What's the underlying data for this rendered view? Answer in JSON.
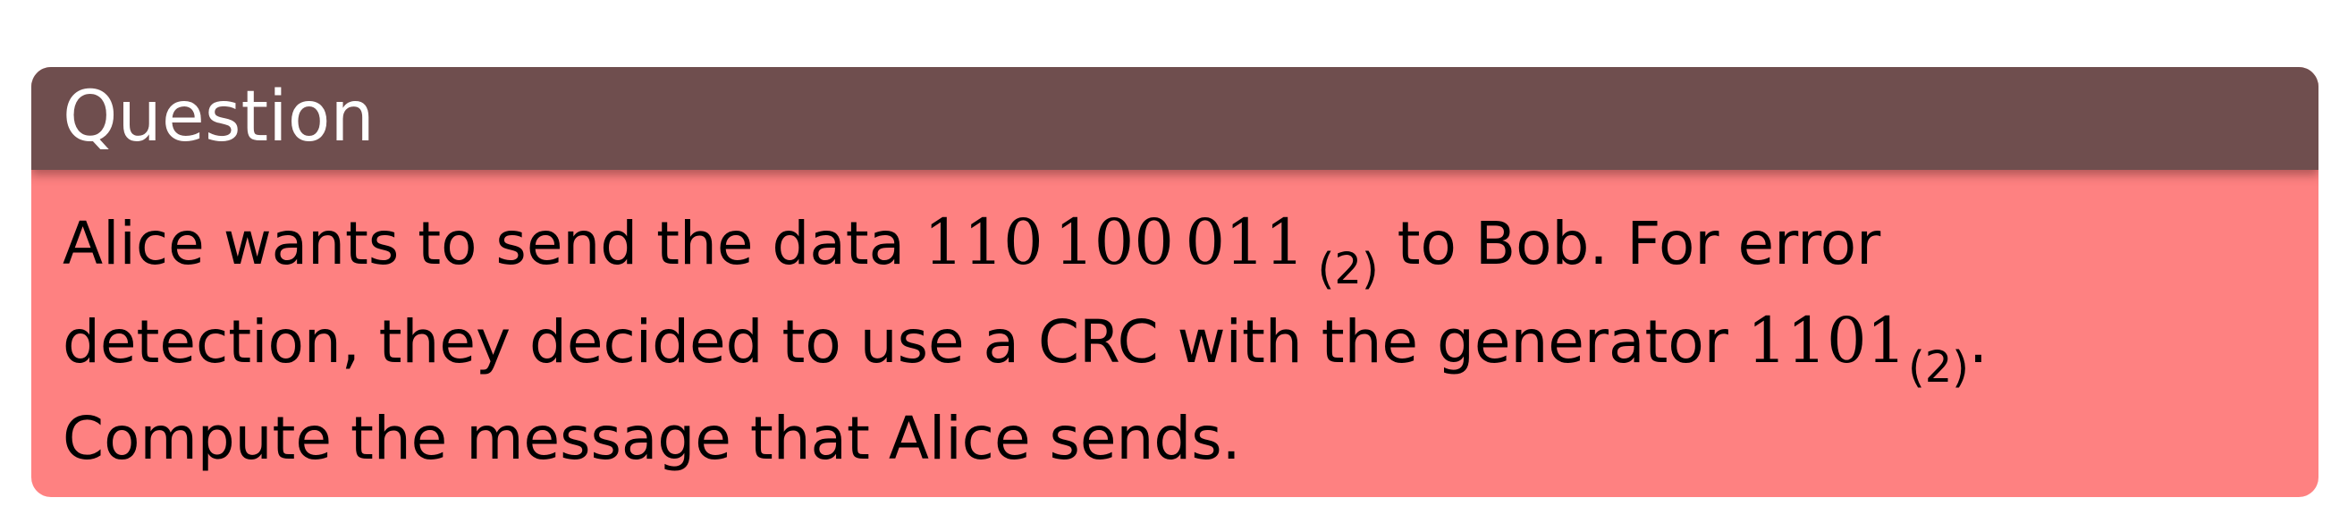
{
  "block": {
    "title": "Question",
    "text": {
      "line1_before": "Alice wants to send the data ",
      "data_groups": [
        "110",
        "100",
        "011"
      ],
      "data_base": "(2)",
      "line1_after": " to Bob. For error",
      "line2_before": "detection, they decided to use a CRC with the generator ",
      "generator": "1101",
      "generator_base": "(2)",
      "line2_after": ".",
      "line3": "Compute the message that Alice sends."
    }
  },
  "colors": {
    "header_bg": "#6f4e4e",
    "body_bg": "#fe8181",
    "title_text": "#ffffff",
    "body_text": "#000000"
  }
}
